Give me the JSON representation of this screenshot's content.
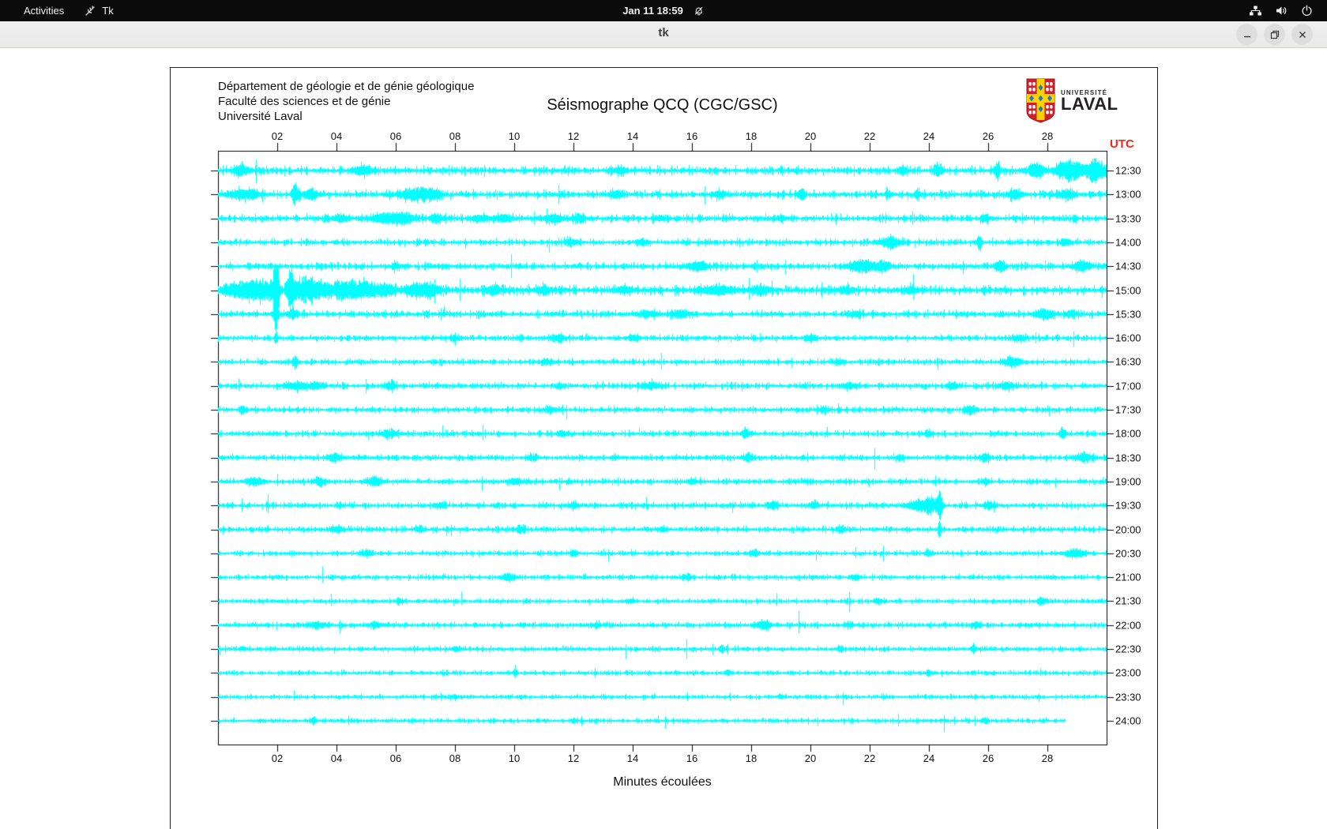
{
  "menubar": {
    "activities": "Activities",
    "app_name": "Tk",
    "clock": "Jan 11 18:59",
    "icons": [
      "tk-feather-icon",
      "notifications-muted-icon",
      "network-wired-icon",
      "volume-icon",
      "power-icon"
    ]
  },
  "titlebar": {
    "title": "tk",
    "icons": [
      "minimize-icon",
      "restore-icon",
      "close-icon"
    ]
  },
  "window": {
    "institution_lines": [
      "Département de géologie et de génie géologique",
      "Faculté des sciences et de génie",
      "Université Laval"
    ],
    "title": "Séismographe QCQ (CGC/GSC)",
    "utc_label": "UTC",
    "xlabel": "Minutes écoulées",
    "logo": {
      "line1": "UNIVERSITÉ",
      "line2": "LAVAL"
    }
  },
  "colors": {
    "trace": "#00ffff",
    "axis": "#000000",
    "utc_red": "#f5281c",
    "logo_red": "#ce202c",
    "logo_yellow": "#ffd100",
    "logo_blue": "#1f7dbf",
    "menubar_bg": "#0b0b0b"
  },
  "chart_data": {
    "type": "line",
    "subtype": "seismogram-helicorder",
    "station": "QCQ (CGC/GSC)",
    "x_range_minutes": [
      0,
      30
    ],
    "minutes_per_row": 30,
    "x_ticks": [
      {
        "label": "02",
        "minute": 2
      },
      {
        "label": "04",
        "minute": 4
      },
      {
        "label": "06",
        "minute": 6
      },
      {
        "label": "08",
        "minute": 8
      },
      {
        "label": "10",
        "minute": 10
      },
      {
        "label": "12",
        "minute": 12
      },
      {
        "label": "14",
        "minute": 14
      },
      {
        "label": "16",
        "minute": 16
      },
      {
        "label": "18",
        "minute": 18
      },
      {
        "label": "20",
        "minute": 20
      },
      {
        "label": "22",
        "minute": 22
      },
      {
        "label": "24",
        "minute": 24
      },
      {
        "label": "26",
        "minute": 26
      },
      {
        "label": "28",
        "minute": 28
      }
    ],
    "rows": [
      {
        "t": "12:30",
        "base": 2.4,
        "end": 30,
        "ev": [
          [
            0.8,
            6,
            0.3
          ],
          [
            4.9,
            5,
            0.35
          ],
          [
            13.5,
            4,
            0.2
          ],
          [
            23.1,
            6,
            0.12
          ],
          [
            24.3,
            7,
            0.15
          ],
          [
            26.3,
            13,
            0.08
          ],
          [
            27.6,
            9,
            0.25
          ],
          [
            28.7,
            13,
            0.45
          ],
          [
            29.6,
            15,
            0.3
          ]
        ]
      },
      {
        "t": "13:00",
        "base": 2.4,
        "end": 30,
        "ev": [
          [
            0.9,
            6,
            0.5
          ],
          [
            2.6,
            13,
            0.12
          ],
          [
            3.1,
            6,
            0.25
          ],
          [
            6.6,
            7,
            0.45
          ],
          [
            7.2,
            5,
            0.3
          ],
          [
            13.4,
            4,
            0.2
          ],
          [
            16.9,
            4,
            0.2
          ],
          [
            19.7,
            6,
            0.12
          ],
          [
            22.6,
            4,
            0.1
          ],
          [
            23.6,
            5,
            0.1
          ],
          [
            26.9,
            6,
            0.2
          ],
          [
            28.6,
            5,
            0.3
          ]
        ]
      },
      {
        "t": "13:30",
        "base": 2.2,
        "end": 30,
        "ev": [
          [
            4.1,
            4,
            0.3
          ],
          [
            5.6,
            6,
            0.45
          ],
          [
            6.3,
            6,
            0.35
          ],
          [
            7.4,
            4,
            0.3
          ],
          [
            8.8,
            4,
            0.3
          ],
          [
            9.6,
            4,
            0.35
          ],
          [
            11.3,
            5,
            0.3
          ],
          [
            12.2,
            5,
            0.2
          ],
          [
            14.9,
            3,
            0.2
          ],
          [
            19.0,
            3,
            0.2
          ],
          [
            25.9,
            4,
            0.15
          ]
        ]
      },
      {
        "t": "14:00",
        "base": 2.0,
        "end": 30,
        "ev": [
          [
            11.9,
            5,
            0.2
          ],
          [
            14.3,
            3,
            0.2
          ],
          [
            22.7,
            6,
            0.35
          ],
          [
            25.7,
            13,
            0.07
          ],
          [
            28.6,
            4,
            0.2
          ]
        ]
      },
      {
        "t": "14:30",
        "base": 2.1,
        "end": 30,
        "ev": [
          [
            6.0,
            3,
            0.2
          ],
          [
            16.2,
            6,
            0.3
          ],
          [
            21.7,
            7,
            0.45
          ],
          [
            22.4,
            5,
            0.3
          ],
          [
            26.4,
            7,
            0.18
          ],
          [
            29.2,
            6,
            0.3
          ]
        ]
      },
      {
        "t": "15:00",
        "base": 2.7,
        "end": 30,
        "ev": [
          [
            0.5,
            7,
            0.5
          ],
          [
            1.1,
            9,
            0.35
          ],
          [
            1.6,
            10,
            0.3
          ],
          [
            1.95,
            52,
            0.1
          ],
          [
            2.45,
            28,
            0.13
          ],
          [
            2.85,
            12,
            0.3
          ],
          [
            3.3,
            9,
            0.4
          ],
          [
            4.2,
            11,
            0.5
          ],
          [
            4.9,
            8,
            0.4
          ],
          [
            5.6,
            6,
            0.4
          ],
          [
            6.6,
            7,
            0.3
          ],
          [
            7.2,
            8,
            0.3
          ],
          [
            9.3,
            5,
            0.3
          ],
          [
            11.0,
            4,
            0.3
          ],
          [
            13.7,
            4,
            0.3
          ],
          [
            16.8,
            5,
            0.6
          ],
          [
            18.3,
            5,
            0.3
          ],
          [
            21.2,
            4,
            0.25
          ],
          [
            23.4,
            3,
            0.3
          ]
        ]
      },
      {
        "t": "15:30",
        "base": 2.1,
        "end": 30,
        "ev": [
          [
            1.95,
            22,
            0.07
          ],
          [
            2.5,
            5,
            0.2
          ],
          [
            14.5,
            4,
            0.3
          ],
          [
            15.6,
            5,
            0.3
          ],
          [
            21.5,
            3,
            0.2
          ],
          [
            27.9,
            6,
            0.3
          ],
          [
            28.8,
            4,
            0.2
          ]
        ]
      },
      {
        "t": "16:00",
        "base": 1.9,
        "end": 30,
        "ev": [
          [
            1.95,
            7,
            0.05
          ],
          [
            8.0,
            3,
            0.2
          ],
          [
            11.5,
            4,
            0.25
          ],
          [
            14.0,
            3,
            0.2
          ],
          [
            20.0,
            3,
            0.2
          ],
          [
            27.0,
            3,
            0.2
          ]
        ]
      },
      {
        "t": "16:30",
        "base": 1.8,
        "end": 30,
        "ev": [
          [
            2.6,
            6,
            0.1
          ],
          [
            11.1,
            3,
            0.2
          ],
          [
            21.0,
            3,
            0.15
          ],
          [
            26.8,
            5,
            0.3
          ]
        ]
      },
      {
        "t": "17:00",
        "base": 1.9,
        "end": 30,
        "ev": [
          [
            2.6,
            4,
            0.4
          ],
          [
            3.3,
            4,
            0.3
          ],
          [
            5.8,
            5,
            0.2
          ],
          [
            11.5,
            3,
            0.2
          ],
          [
            14.6,
            4,
            0.3
          ],
          [
            21.3,
            4,
            0.2
          ],
          [
            24.8,
            4,
            0.2
          ],
          [
            26.6,
            5,
            0.25
          ]
        ]
      },
      {
        "t": "17:30",
        "base": 1.8,
        "end": 30,
        "ev": [
          [
            0.8,
            6,
            0.1
          ],
          [
            11.2,
            3,
            0.2
          ],
          [
            20.4,
            3,
            0.15
          ],
          [
            25.4,
            6,
            0.15
          ]
        ]
      },
      {
        "t": "18:00",
        "base": 1.8,
        "end": 30,
        "ev": [
          [
            5.8,
            4,
            0.3
          ],
          [
            11.6,
            3,
            0.2
          ],
          [
            17.8,
            5,
            0.15
          ],
          [
            24.0,
            3,
            0.15
          ],
          [
            28.5,
            6,
            0.1
          ]
        ]
      },
      {
        "t": "18:30",
        "base": 1.8,
        "end": 30,
        "ev": [
          [
            3.9,
            5,
            0.2
          ],
          [
            10.6,
            3,
            0.2
          ],
          [
            17.9,
            4,
            0.2
          ],
          [
            23.0,
            3,
            0.15
          ],
          [
            25.9,
            5,
            0.15
          ],
          [
            29.2,
            5,
            0.3
          ]
        ]
      },
      {
        "t": "19:00",
        "base": 1.8,
        "end": 30,
        "ev": [
          [
            1.2,
            5,
            0.3
          ],
          [
            3.4,
            5,
            0.2
          ],
          [
            5.3,
            5,
            0.25
          ],
          [
            10.0,
            3,
            0.2
          ],
          [
            16.0,
            3,
            0.2
          ],
          [
            25.9,
            4,
            0.1
          ]
        ]
      },
      {
        "t": "19:30",
        "base": 1.9,
        "end": 30,
        "ev": [
          [
            7.5,
            3,
            0.2
          ],
          [
            12.0,
            3,
            0.2
          ],
          [
            18.7,
            5,
            0.15
          ],
          [
            20.1,
            4,
            0.1
          ],
          [
            23.7,
            7,
            0.4
          ],
          [
            24.05,
            9,
            0.15
          ],
          [
            24.35,
            18,
            0.1
          ],
          [
            26.0,
            4,
            0.2
          ]
        ]
      },
      {
        "t": "20:00",
        "base": 1.8,
        "end": 30,
        "ev": [
          [
            4.0,
            4,
            0.2
          ],
          [
            6.8,
            4,
            0.15
          ],
          [
            10.2,
            4,
            0.15
          ],
          [
            15.0,
            3,
            0.15
          ],
          [
            21.0,
            3,
            0.15
          ],
          [
            24.35,
            11,
            0.05
          ]
        ]
      },
      {
        "t": "20:30",
        "base": 1.6,
        "end": 30,
        "ev": [
          [
            5.0,
            3,
            0.2
          ],
          [
            12.0,
            3,
            0.15
          ],
          [
            18.1,
            4,
            0.15
          ],
          [
            24.0,
            3,
            0.15
          ],
          [
            28.9,
            5,
            0.35
          ]
        ]
      },
      {
        "t": "21:00",
        "base": 1.6,
        "end": 30,
        "ev": [
          [
            9.8,
            5,
            0.2
          ],
          [
            15.8,
            4,
            0.15
          ],
          [
            21.5,
            3,
            0.15
          ]
        ]
      },
      {
        "t": "21:30",
        "base": 1.5,
        "end": 30,
        "ev": [
          [
            6.1,
            4,
            0.1
          ],
          [
            13.9,
            3,
            0.15
          ],
          [
            22.3,
            3,
            0.15
          ],
          [
            27.8,
            4,
            0.15
          ]
        ]
      },
      {
        "t": "22:00",
        "base": 1.7,
        "end": 30,
        "ev": [
          [
            3.3,
            4,
            0.3
          ],
          [
            5.3,
            4,
            0.2
          ],
          [
            12.8,
            3,
            0.15
          ],
          [
            18.4,
            5,
            0.25
          ],
          [
            21.3,
            3,
            0.15
          ],
          [
            25.6,
            4,
            0.15
          ]
        ]
      },
      {
        "t": "22:30",
        "base": 1.6,
        "end": 30,
        "ev": [
          [
            8.0,
            3,
            0.15
          ],
          [
            17.0,
            4,
            0.1
          ],
          [
            21.0,
            4,
            0.1
          ],
          [
            25.5,
            5,
            0.1
          ]
        ]
      },
      {
        "t": "23:00",
        "base": 1.5,
        "end": 30,
        "ev": [
          [
            10.0,
            3,
            0.1
          ],
          [
            17.2,
            4,
            0.1
          ],
          [
            24.0,
            3,
            0.1
          ]
        ]
      },
      {
        "t": "23:30",
        "base": 1.4,
        "end": 30,
        "ev": [
          [
            8.0,
            2,
            0.15
          ],
          [
            19.0,
            2,
            0.15
          ]
        ]
      },
      {
        "t": "24:00",
        "base": 1.5,
        "end": 28.6,
        "ev": [
          [
            3.2,
            4,
            0.1
          ],
          [
            12.0,
            3,
            0.1
          ],
          [
            25.9,
            4,
            0.1
          ]
        ]
      }
    ]
  }
}
